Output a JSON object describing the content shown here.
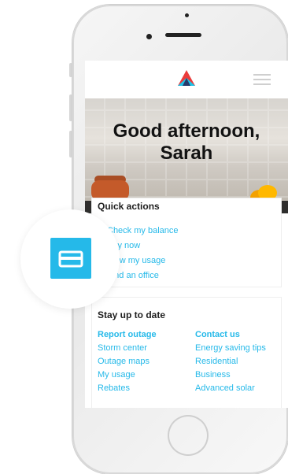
{
  "hero": {
    "greeting": "Good afternoon,",
    "name": "Sarah"
  },
  "quick_actions": {
    "title": "Quick actions",
    "items": [
      {
        "label": "Check my balance"
      },
      {
        "label": "Pay now"
      },
      {
        "label": "View my usage"
      },
      {
        "label": "Find an office"
      }
    ]
  },
  "stay_up_to_date": {
    "title": "Stay up to date",
    "left_column": {
      "heading": "Report outage",
      "links": [
        "Storm center",
        "Outage maps",
        "My usage",
        "Rebates"
      ]
    },
    "right_column": {
      "heading": "Contact us",
      "links": [
        "Energy saving tips",
        "Residential",
        "Business",
        "Advanced solar"
      ]
    }
  },
  "colors": {
    "accent": "#25b9e9",
    "logo_red": "#ea3b3b",
    "logo_cyan": "#1ec3e6",
    "logo_navy": "#263a6b"
  },
  "icons": {
    "bubble": "credit-card-icon",
    "menu": "hamburger-menu-icon",
    "logo": "triangle-logo-icon"
  }
}
